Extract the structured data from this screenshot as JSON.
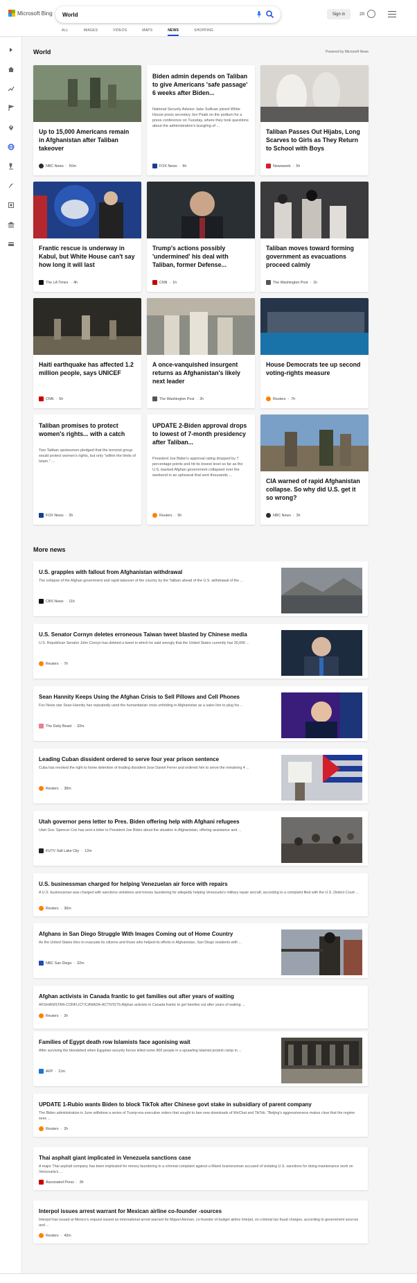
{
  "header": {
    "brand": "Microsoft Bing",
    "search_value": "World",
    "signin_label": "Sign in",
    "rewards_count": "20",
    "tabs": [
      "ALL",
      "IMAGES",
      "VIDEOS",
      "MAPS",
      "NEWS",
      "SHOPPING"
    ],
    "active_tab": "NEWS"
  },
  "sidebar": {
    "icons": [
      "play-icon",
      "home-icon",
      "trending-icon",
      "flag-icon",
      "location-pin-icon",
      "globe-icon",
      "microscope-icon",
      "rocket-icon",
      "film-icon",
      "bank-icon",
      "card-icon"
    ]
  },
  "world": {
    "title": "World",
    "powered_by": "Powered by Microsoft News",
    "cards": [
      {
        "title": "Up to 15,000 Americans remain in Afghanistan after Taliban takeover",
        "source": "NBC News",
        "time": "50m",
        "desc": ""
      },
      {
        "title": "Biden admin depends on Taliban to give Americans 'safe passage' 6 weeks after Biden...",
        "source": "FOX News",
        "time": "6h",
        "desc": "National Security Advisor Jake Sullivan joined White House press secretary Jen Psaki on the podium for a press conference on Tuesday, where they took questions about the administration's bungling of ..."
      },
      {
        "title": "Taliban Passes Out Hijabs, Long Scarves to Girls as They Return to School with Boys",
        "source": "Newsweek",
        "time": "5h",
        "desc": ""
      },
      {
        "title": "Frantic rescue is underway in Kabul, but White House can't say how long it will last",
        "source": "The LA Times",
        "time": "4h",
        "desc": ""
      },
      {
        "title": "Trump's actions possibly 'undermined' his deal with Taliban, former Defense...",
        "source": "CNN",
        "time": "1h",
        "desc": ""
      },
      {
        "title": "Taliban moves toward forming government as evacuations proceed calmly",
        "source": "The Washington Post",
        "time": "1h",
        "desc": ""
      },
      {
        "title": "Haiti earthquake has affected 1.2 million people, says UNICEF",
        "source": "CNN",
        "time": "5h",
        "desc": ""
      },
      {
        "title": "A once-vanquished insurgent returns as Afghanistan's likely next leader",
        "source": "The Washington Post",
        "time": "2h",
        "desc": ""
      },
      {
        "title": "House Democrats tee up second voting-rights measure",
        "source": "Reuters",
        "time": "7h",
        "desc": ""
      },
      {
        "title": "Taliban promises to protect women's rights... with a catch",
        "source": "FOX News",
        "time": "3h",
        "desc": "Two Taliban spokesmen pledged that the terrorist group would protect women's rights, but only \"within the limits of Islam.\" ..."
      },
      {
        "title": "UPDATE 2-Biden approval drops to lowest of 7-month presidency after Taliban...",
        "source": "Reuters",
        "time": "5h",
        "desc": "President Joe Biden's approval rating dropped by 7 percentage points and hit its lowest level so far as the U.S.-backed Afghan government collapsed over the weekend in an upheaval that sent thousands ..."
      },
      {
        "title": "CIA warned of rapid Afghanistan collapse. So why did U.S. get it so wrong?",
        "source": "NBC News",
        "time": "3h",
        "desc": ""
      }
    ]
  },
  "more": {
    "title": "More news",
    "items": [
      {
        "title": "U.S. grapples with fallout from Afghanistan withdrawal",
        "desc": "The collapse of the Afghan government and rapid takeover of the country by the Taliban ahead of the U.S. withdrawal of the ...",
        "source": "CBS News",
        "time": "11h"
      },
      {
        "title": "U.S. Senator Cornyn deletes erroneous Taiwan tweet blasted by Chinese media",
        "desc": "U.S. Republican Senator John Cornyn has deleted a tweet in which he said wrongly that the United States currently has 30,000 ...",
        "source": "Reuters",
        "time": "7h"
      },
      {
        "title": "Sean Hannity Keeps Using the Afghan Crisis to Sell Pillows and Cell Phones",
        "desc": "Fox News star Sean Hannity has repeatedly used the humanitarian crisis unfolding in Afghanistan as a sales line to plug his ...",
        "source": "The Daily Beast",
        "time": "32m"
      },
      {
        "title": "Leading Cuban dissident ordered to serve four year prison sentence",
        "desc": "Cuba has revoked the right to home detention of leading dissident Jose Daniel Ferrer and ordered him to serve the remaining 4 ...",
        "source": "Reuters",
        "time": "38m"
      },
      {
        "title": "Utah governor pens letter to Pres. Biden offering help with Afghani refugees",
        "desc": "Utah Gov. Spencer Cox has sent a letter to President Joe Biden about the situation in Afghanistan, offering assistance and ...",
        "source": "KUTV Salt Lake City",
        "time": "12m"
      },
      {
        "title": "U.S. businessman charged for helping Venezuelan air force with repairs",
        "desc": "A U.S. businessman was charged with sanctions violations and money laundering for allegedly helping Venezuela's military repair aircraft, according to a complaint filed with the U.S. District Court ...",
        "source": "Reuters",
        "time": "36m"
      },
      {
        "title": "Afghans in San Diego Struggle With Images Coming out of Home Country",
        "desc": "As the United States tries to evacuate its citizens and those who helped its efforts in Afghanistan, San Diego residents with ...",
        "source": "NBC San Diego",
        "time": "32m"
      },
      {
        "title": "Afghan activists in Canada frantic to get families out after years of waiting",
        "desc": "AFGHANISTAN-CONFLICT/CANADA-ACTIVISTS:Afghan activists in Canada frantic to get families out after years of waiting ...",
        "source": "Reuters",
        "time": "2h"
      },
      {
        "title": "Families of Egypt death row Islamists face agonising wait",
        "desc": "After surviving the bloodshed when Egyptian security forces killed some 800 people in a sprawling Islamist protest camp in ...",
        "source": "AFP",
        "time": "11m"
      },
      {
        "title": "UPDATE 1-Rubio wants Biden to block TikTok after Chinese govt stake in subsidiary of parent company",
        "desc": "The Biden administration in June withdrew a series of Trump-era executive orders that sought to ban new downloads of WeChat and TikTok. \"Beijing's aggressiveness makes clear that the regime sees ...",
        "source": "Reuters",
        "time": "2h"
      },
      {
        "title": "Thai asphalt giant implicated in Venezuela sanctions case",
        "desc": "A major Thai asphalt company has been implicated for money laundering in a criminal complaint against a Miami businessman accused of violating U.S. sanctions for doing maintenance work on Venezuela's ...",
        "source": "Associated Press",
        "time": "3h"
      },
      {
        "title": "Interpol issues arrest warrant for Mexican airline co-founder -sources",
        "desc": "Interpol has issued at Mexico's request issued an international arrest warrant for Miguel Aleman, co-founder of budget airline Interjet, on criminal tax fraud charges, according to government sources and ...",
        "source": "Reuters",
        "time": "42m"
      }
    ]
  },
  "footer": {
    "text": ""
  }
}
